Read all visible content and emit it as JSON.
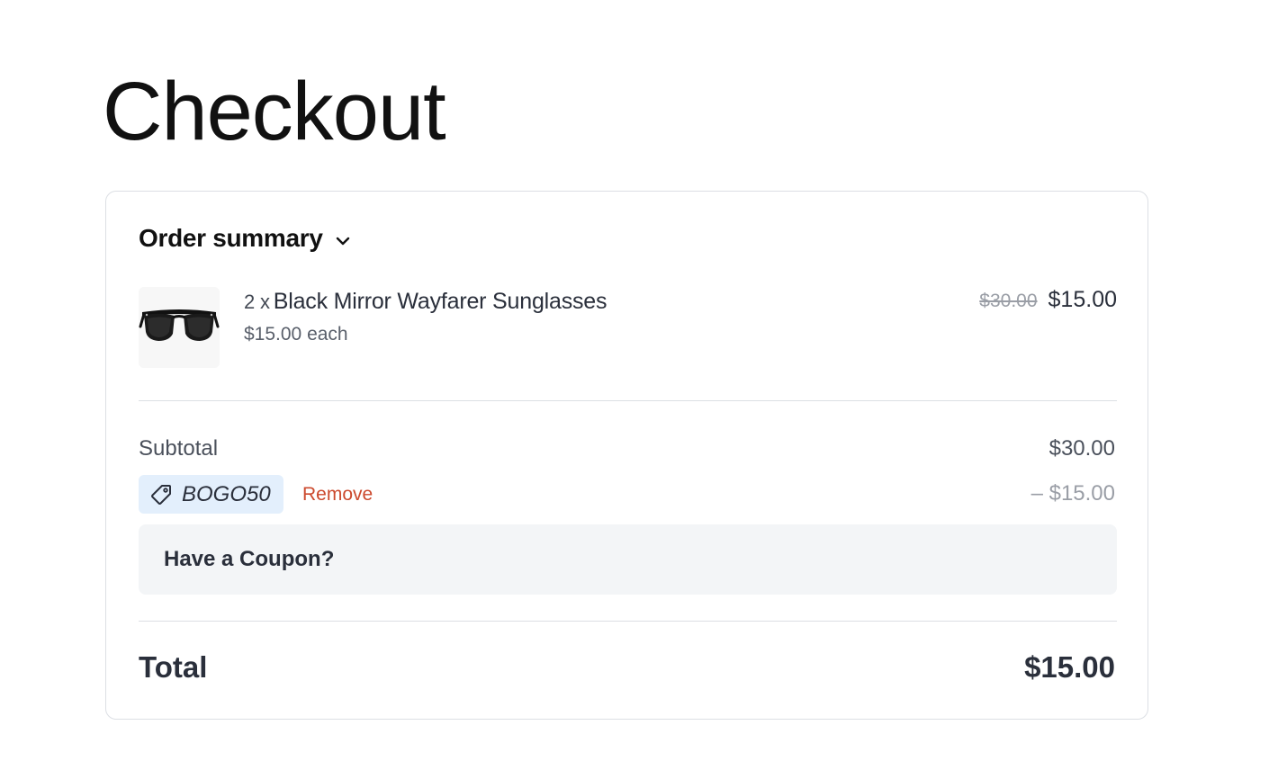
{
  "page": {
    "title": "Checkout"
  },
  "summary": {
    "title": "Order summary",
    "toggle_icon": "chevron-down-icon"
  },
  "item": {
    "quantity": "2 x",
    "name": "Black Mirror Wayfarer Sunglasses",
    "unit_price": "$15.00 each",
    "original_price": "$30.00",
    "price": "$15.00",
    "image_icon": "sunglasses-product-image"
  },
  "totals": {
    "subtotal_label": "Subtotal",
    "subtotal_value": "$30.00",
    "discount_value": "– $15.00",
    "total_label": "Total",
    "total_value": "$15.00"
  },
  "coupon": {
    "code": "BOGO50",
    "icon": "tag-icon",
    "remove_label": "Remove",
    "prompt_label": "Have a Coupon?"
  },
  "colors": {
    "coupon_chip_bg": "#e3effc",
    "remove_link": "#cc4a2e",
    "coupon_box_bg": "#f3f5f7",
    "muted_text": "#9a9ea6"
  }
}
